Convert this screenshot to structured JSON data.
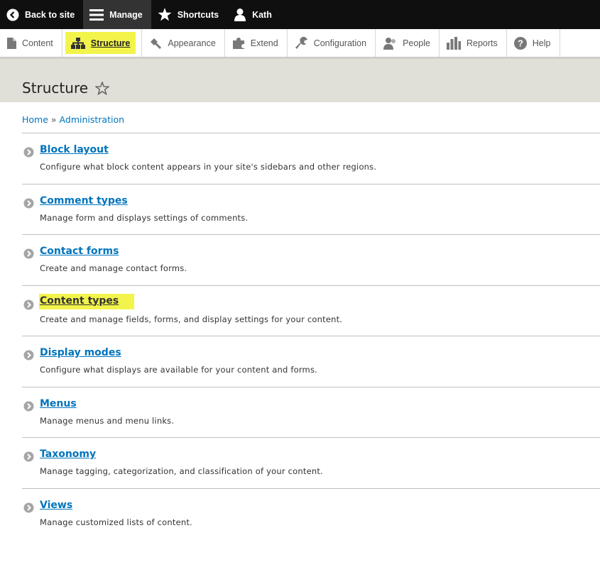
{
  "toolbar": {
    "back_to_site": "Back to site",
    "manage": "Manage",
    "shortcuts": "Shortcuts",
    "user": "Kath"
  },
  "tray": {
    "items": [
      {
        "label": "Content",
        "icon": "file-icon"
      },
      {
        "label": "Structure",
        "icon": "sitemap-icon"
      },
      {
        "label": "Appearance",
        "icon": "paint-icon"
      },
      {
        "label": "Extend",
        "icon": "puzzle-icon"
      },
      {
        "label": "Configuration",
        "icon": "wrench-icon"
      },
      {
        "label": "People",
        "icon": "people-icon"
      },
      {
        "label": "Reports",
        "icon": "chart-icon"
      },
      {
        "label": "Help",
        "icon": "help-icon"
      }
    ]
  },
  "page": {
    "title": "Structure"
  },
  "breadcrumb": {
    "home": "Home",
    "separator": "»",
    "admin": "Administration"
  },
  "list": [
    {
      "title": "Block layout",
      "desc": "Configure what block content appears in your site's sidebars and other regions."
    },
    {
      "title": "Comment types",
      "desc": "Manage form and displays settings of comments."
    },
    {
      "title": "Contact forms",
      "desc": "Create and manage contact forms."
    },
    {
      "title": "Content types",
      "desc": "Create and manage fields, forms, and display settings for your content."
    },
    {
      "title": "Display modes",
      "desc": "Configure what displays are available for your content and forms."
    },
    {
      "title": "Menus",
      "desc": "Manage menus and menu links."
    },
    {
      "title": "Taxonomy",
      "desc": "Manage tagging, categorization, and classification of your content."
    },
    {
      "title": "Views",
      "desc": "Manage customized lists of content."
    }
  ],
  "colors": {
    "link": "#0074bd",
    "highlight": "#f3f44b",
    "toolbar": "#0f0f0f",
    "header": "#e0e0d8"
  }
}
